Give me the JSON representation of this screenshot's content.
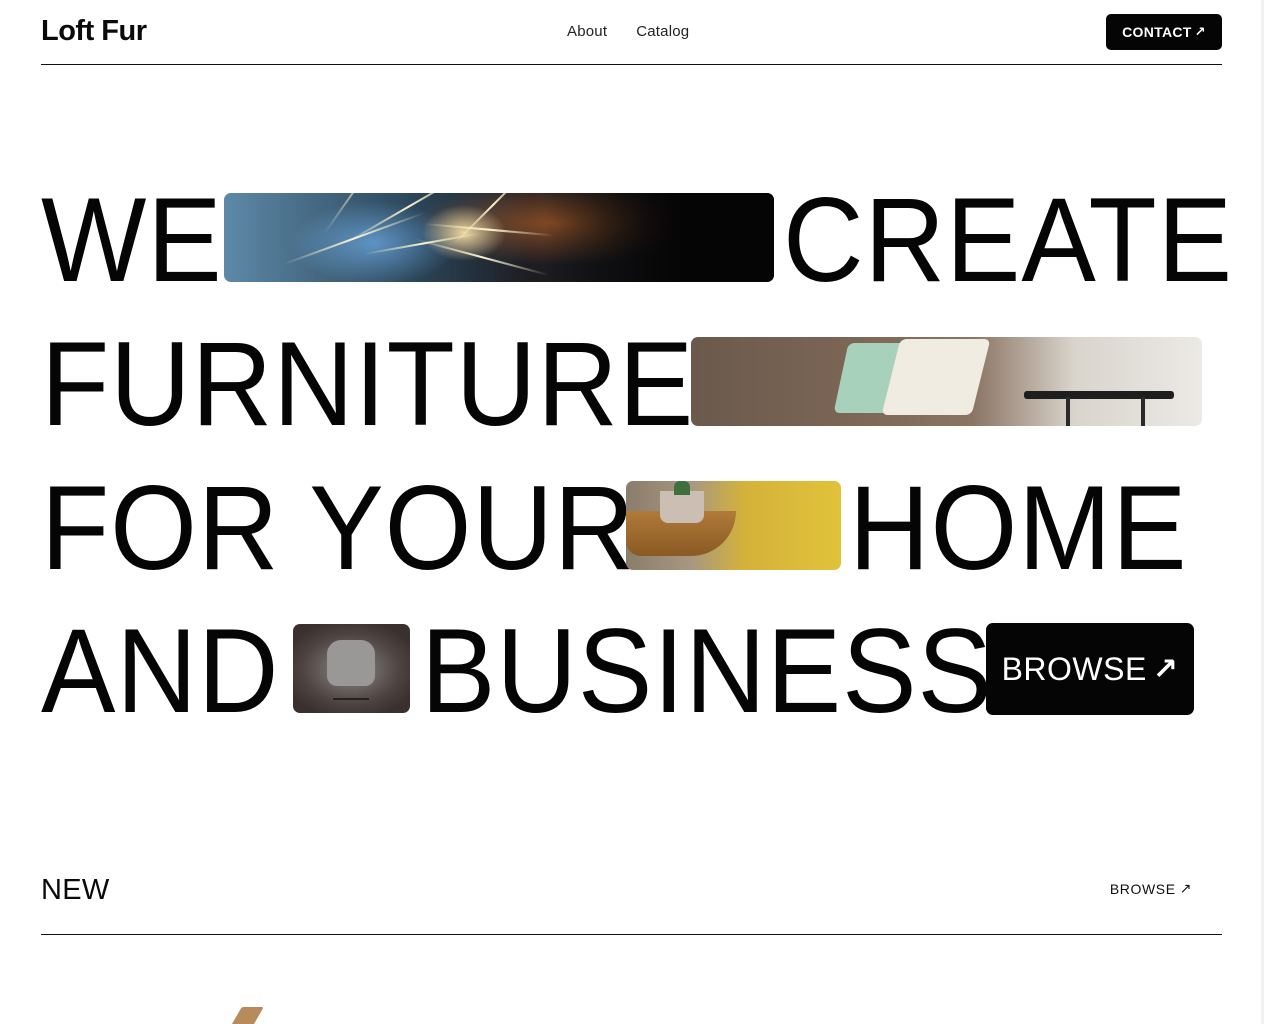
{
  "header": {
    "logo": "Loft Fur",
    "nav": [
      "About",
      "Catalog"
    ],
    "contact_label": "CONTACT",
    "contact_icon": "arrow-up-right-icon"
  },
  "hero": {
    "line1": {
      "before": "WE",
      "after": "CREATE"
    },
    "line2": {
      "before": "FURNITURE"
    },
    "line3": {
      "before": "FOR YOUR",
      "after": "HOME"
    },
    "line4": {
      "before": "AND",
      "after": "BUSINESS"
    },
    "browse_label": "BROWSE",
    "browse_icon": "arrow-up-right-icon"
  },
  "new_section": {
    "title": "NEW",
    "browse_label": "BROWSE",
    "browse_icon": "arrow-up-right-icon"
  },
  "colors": {
    "text": "#050505",
    "button_bg": "#050505",
    "button_text": "#ffffff",
    "background": "#ffffff"
  }
}
